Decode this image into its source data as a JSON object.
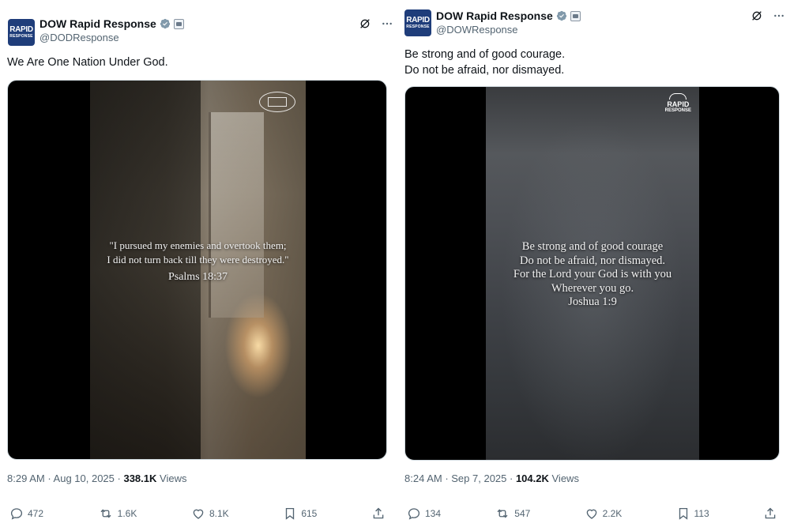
{
  "tweets": [
    {
      "display_name": "DOW Rapid Response",
      "handle": "@DODResponse",
      "avatar_text": [
        "RAPID",
        "RESPONSE"
      ],
      "text_lines": [
        "We Are One Nation Under God."
      ],
      "media_quote": [
        "\"I pursued my enemies and overtook them;",
        "I did not turn back till they were destroyed.\""
      ],
      "media_ref": "Psalms 18:37",
      "time": "8:29 AM",
      "date": "Aug 10, 2025",
      "views_count": "338.1K",
      "views_label": "Views",
      "replies": "472",
      "reposts": "1.6K",
      "likes": "8.1K",
      "bookmarks": "615"
    },
    {
      "display_name": "DOW Rapid Response",
      "handle": "@DOWResponse",
      "avatar_text": [
        "RAPID",
        "RESPONSE"
      ],
      "text_lines": [
        "Be strong and of good courage.",
        "Do not be afraid, nor dismayed."
      ],
      "media_quote": [
        "Be strong and of good courage",
        "Do not be afraid, nor dismayed.",
        "For the Lord your God is with you",
        "Wherever you go."
      ],
      "media_ref": "Joshua 1:9",
      "media_logo": [
        "RAPID",
        "RESPONSE"
      ],
      "time": "8:24 AM",
      "date": "Sep 7, 2025",
      "views_count": "104.2K",
      "views_label": "Views",
      "replies": "134",
      "reposts": "547",
      "likes": "2.2K",
      "bookmarks": "113"
    }
  ],
  "colors": {
    "text_primary": "#0f1419",
    "text_secondary": "#536471",
    "verified_blue": "#1d9bf0",
    "avatar_navy": "#1f3d7a"
  },
  "icons": [
    "verified-icon",
    "grok-icon",
    "more-icon",
    "reply-icon",
    "repost-icon",
    "like-icon",
    "bookmark-icon",
    "share-icon"
  ]
}
